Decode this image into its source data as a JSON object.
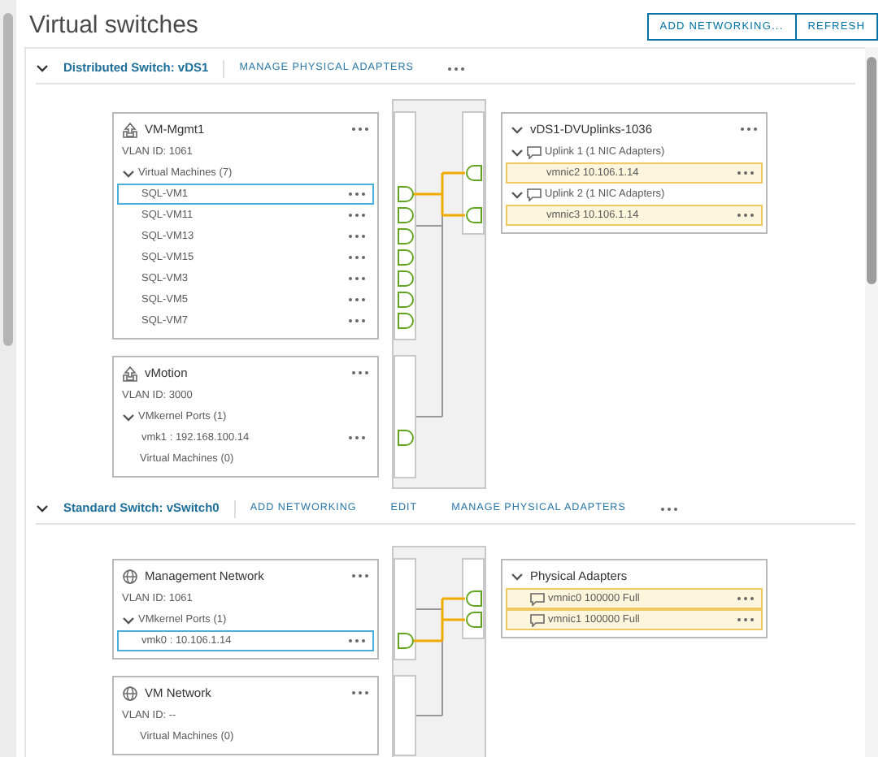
{
  "page_title": "Virtual switches",
  "toolbar_buttons": [
    "ADD NETWORKING...",
    "REFRESH"
  ],
  "switches": [
    {
      "kind": "distributed",
      "title": "Distributed Switch: vDS1",
      "expanded": true,
      "actions": [
        "MANAGE PHYSICAL ADAPTERS"
      ],
      "port_groups": [
        {
          "name": "VM-Mgmt1",
          "vlan": "VLAN ID: 1061",
          "sections": [
            {
              "label": "Virtual Machines (7)",
              "expanded": true,
              "items": [
                {
                  "name": "SQL-VM1",
                  "selected": true
                },
                {
                  "name": "SQL-VM11",
                  "selected": false
                },
                {
                  "name": "SQL-VM13",
                  "selected": false
                },
                {
                  "name": "SQL-VM15",
                  "selected": false
                },
                {
                  "name": "SQL-VM3",
                  "selected": false
                },
                {
                  "name": "SQL-VM5",
                  "selected": false
                },
                {
                  "name": "SQL-VM7",
                  "selected": false
                }
              ]
            }
          ]
        },
        {
          "name": "vMotion",
          "vlan": "VLAN ID: 3000",
          "sections": [
            {
              "label": "VMkernel Ports (1)",
              "expanded": true,
              "items": [
                {
                  "name": "vmk1 : 192.168.100.14",
                  "selected": false
                }
              ]
            },
            {
              "label": "Virtual Machines (0)"
            }
          ]
        }
      ],
      "uplink_card": {
        "name": "vDS1-DVUplinks-1036",
        "expanded": true,
        "groups": [
          {
            "label": "Uplink 1 (1 NIC Adapters)",
            "expanded": true,
            "adapters": [
              {
                "name": "vmnic2 10.106.1.14",
                "highlighted": true
              }
            ]
          },
          {
            "label": "Uplink 2 (1 NIC Adapters)",
            "expanded": true,
            "adapters": [
              {
                "name": "vmnic3 10.106.1.14",
                "highlighted": true
              }
            ]
          }
        ]
      }
    },
    {
      "kind": "standard",
      "title": "Standard Switch: vSwitch0",
      "expanded": true,
      "actions": [
        "ADD NETWORKING",
        "EDIT",
        "MANAGE PHYSICAL ADAPTERS"
      ],
      "port_groups": [
        {
          "name": "Management Network",
          "vlan": "VLAN ID: 1061",
          "sections": [
            {
              "label": "VMkernel Ports (1)",
              "expanded": true,
              "items": [
                {
                  "name": "vmk0 : 10.106.1.14",
                  "selected": true
                }
              ]
            }
          ]
        },
        {
          "name": "VM Network",
          "vlan": "VLAN ID: --",
          "sections": [
            {
              "label": "Virtual Machines (0)"
            }
          ]
        }
      ],
      "uplink_card": {
        "name": "Physical Adapters",
        "expanded": true,
        "adapters": [
          {
            "name": "vmnic0 100000 Full",
            "highlighted": true
          },
          {
            "name": "vmnic1 100000 Full",
            "highlighted": true
          }
        ]
      }
    }
  ]
}
